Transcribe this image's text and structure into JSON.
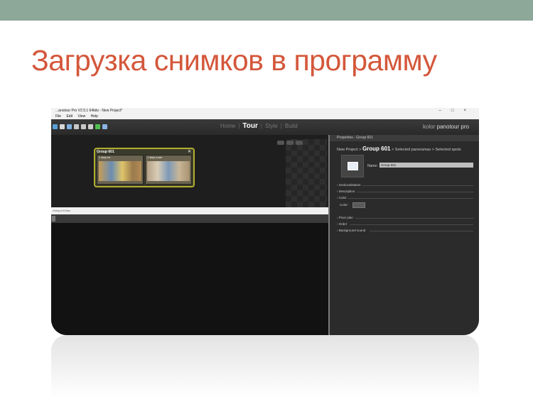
{
  "slide": {
    "title": "Загрузка снимков в программу"
  },
  "window": {
    "title": "...anotour Pro V2.5.1 64bits - New Project*",
    "controls": [
      "–",
      "□",
      "×"
    ]
  },
  "menu": [
    "File",
    "Edit",
    "View",
    "Help"
  ],
  "toolbar": {
    "icons": [
      "add-icon",
      "save-icon",
      "export-icon",
      "undo-icon",
      "redo-icon",
      "settings-icon",
      "play-icon",
      "publish-icon"
    ],
    "icon_colors": [
      "#5aa0d8",
      "#d8d8d8",
      "#7fb0e0",
      "#c8c8c8",
      "#c8c8c8",
      "#cfcfcf",
      "#4fbf4f",
      "#8ab4e6"
    ]
  },
  "nav": {
    "home": "Home",
    "tour": "Tour",
    "style": "Style",
    "build": "Build"
  },
  "brand": {
    "kolor": "kolor",
    "product": "panotour pro"
  },
  "group": {
    "title": "Group 601",
    "thumbs": [
      {
        "label": "1 step ne"
      },
      {
        "label": "1 step ruuer"
      }
    ]
  },
  "hotspot_editor": {
    "title": "Hotspot Editor"
  },
  "properties": {
    "header": "Properties - Group 601",
    "crumb_project": "New Project",
    "crumb_group": "Group 601",
    "crumb_rest": "Selected panoramas > Selected spots",
    "name_label": "Name:",
    "name_value": "Group 601",
    "sections": {
      "geolocalisation": "Geolocalisation",
      "description": "Description",
      "color": "Color",
      "color_label": "Color:",
      "floor_plan": "Floor plan",
      "order": "Order",
      "background_sound": "Background sound"
    }
  },
  "colors": {
    "accent_title": "#d4573b",
    "top_bar": "#8da898",
    "group_border": "#b3ad2e"
  }
}
